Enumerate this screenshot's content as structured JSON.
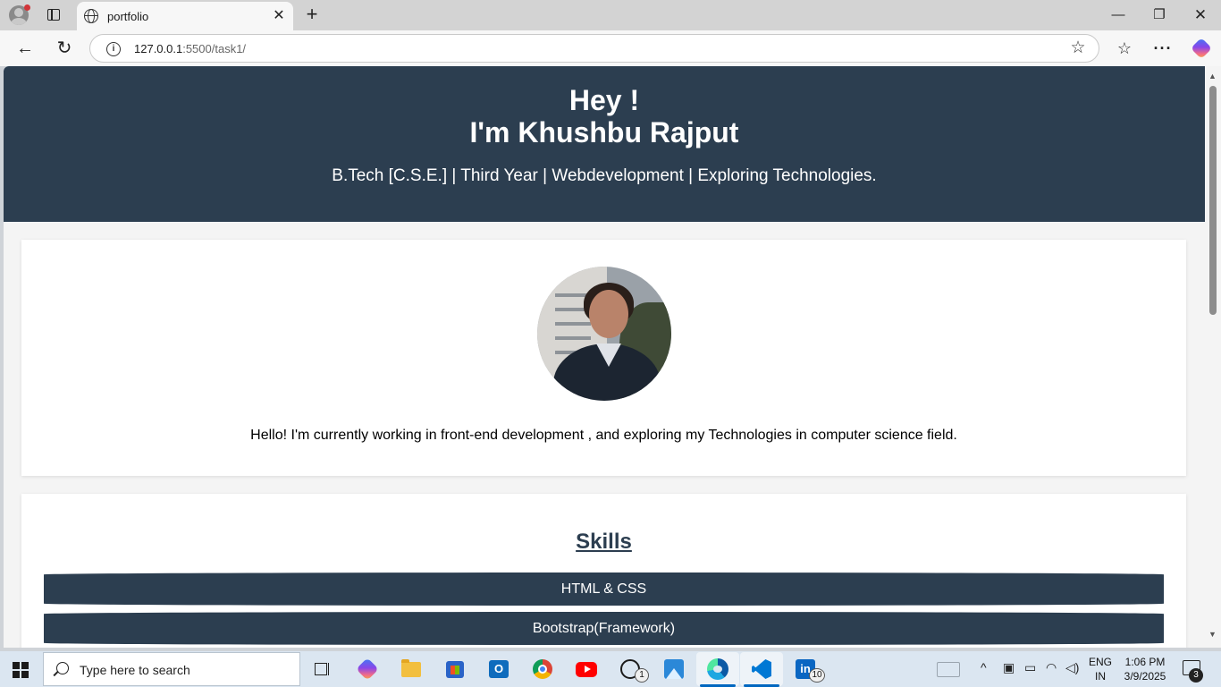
{
  "browser": {
    "tab_title": "portfolio",
    "url_host": "127.0.0.1",
    "url_path": ":5500/task1/",
    "tab_close_glyph": "✕",
    "new_tab_glyph": "+",
    "window_controls": {
      "minimize": "—",
      "maximize": "❐",
      "close": "✕"
    },
    "nav": {
      "back": "←",
      "reload": "↻"
    },
    "info_glyph": "i",
    "star_glyph": "☆",
    "favorites_glyph": "☆",
    "more_glyph": "···"
  },
  "hero": {
    "greeting": "Hey !",
    "name": "I'm Khushbu Rajput",
    "tagline": "B.Tech [C.S.E.] | Third Year | Webdevelopment | Exploring Technologies.",
    "background_color": "#2c3e50"
  },
  "about": {
    "text": "Hello! I'm currently working in front-end development , and exploring my Technologies in computer science field."
  },
  "skills": {
    "title": "Skills",
    "items": [
      "HTML & CSS",
      "Bootstrap(Framework)"
    ]
  },
  "taskbar": {
    "search_placeholder": "Type here to search",
    "apps": [
      "task-view",
      "copilot",
      "file-explorer",
      "microsoft-store",
      "outlook",
      "chrome",
      "youtube",
      "whatsapp",
      "photos",
      "edge",
      "vscode",
      "linkedin"
    ],
    "outlook_letter": "O",
    "linkedin_letters": "in",
    "whatsapp_badge": "1",
    "linkedin_badge": "10",
    "tray": {
      "chevron": "^",
      "lang_line1": "ENG",
      "lang_line2": "IN"
    },
    "clock": {
      "time": "1:06 PM",
      "date": "3/9/2025"
    },
    "notification_count": "3"
  }
}
